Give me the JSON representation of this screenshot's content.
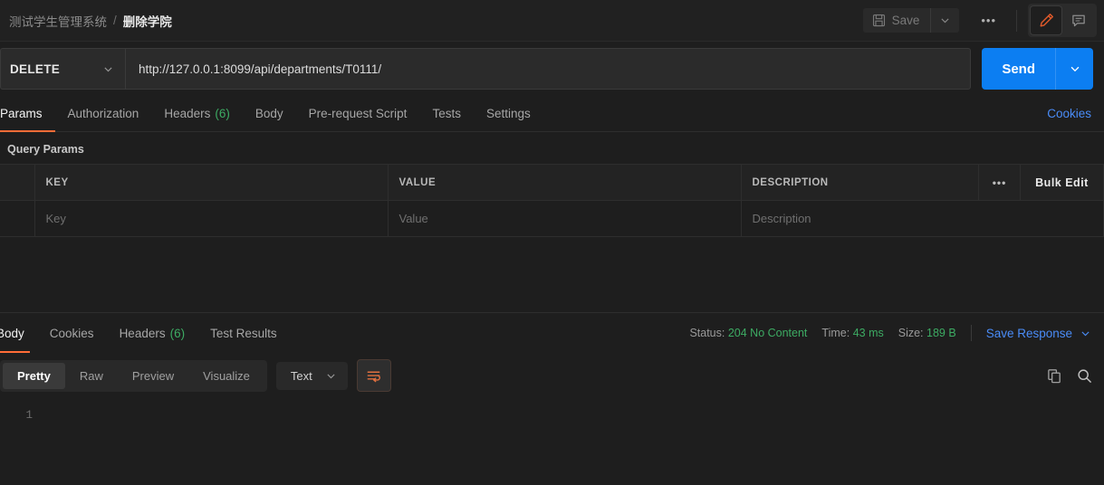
{
  "topbar": {
    "breadcrumb": {
      "collection": "测试学生管理系统",
      "separator": "/",
      "current": "删除学院"
    },
    "save_label": "Save",
    "save_icon": "floppy-disk-icon",
    "save_caret_icon": "chevron-down-icon",
    "more_label": "•••",
    "edit_icon": "pencil-icon",
    "comment_icon": "comment-icon",
    "accent_orange": "#ff6c37"
  },
  "request": {
    "method": "DELETE",
    "method_caret_icon": "chevron-down-icon",
    "url": "http://127.0.0.1:8099/api/departments/T0111/",
    "url_placeholder": "Enter request URL",
    "send_label": "Send",
    "send_caret_icon": "chevron-down-icon",
    "send_color": "#0c7ef2",
    "tabs": [
      {
        "label": "Params",
        "active": true
      },
      {
        "label": "Authorization",
        "active": false
      },
      {
        "label": "Headers",
        "count": "(6)",
        "active": false
      },
      {
        "label": "Body",
        "active": false
      },
      {
        "label": "Pre-request Script",
        "active": false
      },
      {
        "label": "Tests",
        "active": false
      },
      {
        "label": "Settings",
        "active": false
      }
    ],
    "cookies_label": "Cookies",
    "cookies_color": "#4a8cf7"
  },
  "query_params": {
    "title": "Query Params",
    "headers": {
      "key": "KEY",
      "value": "VALUE",
      "description": "DESCRIPTION"
    },
    "more_icon": "•••",
    "bulk_edit_label": "Bulk Edit",
    "rows": [
      {
        "key": "Key",
        "value": "Value",
        "description": "Description",
        "placeholder": true
      }
    ]
  },
  "response": {
    "tabs": [
      {
        "label": "Body",
        "active": true
      },
      {
        "label": "Cookies",
        "active": false
      },
      {
        "label": "Headers",
        "count": "(6)",
        "active": false
      },
      {
        "label": "Test Results",
        "active": false
      }
    ],
    "status_label": "Status:",
    "status_value": "204 No Content",
    "time_label": "Time:",
    "time_value": "43 ms",
    "size_label": "Size:",
    "size_value": "189 B",
    "status_color": "#3dab63",
    "save_response_label": "Save Response",
    "save_response_caret_icon": "chevron-down-icon",
    "viewer_modes": [
      {
        "label": "Pretty",
        "active": true
      },
      {
        "label": "Raw",
        "active": false
      },
      {
        "label": "Preview",
        "active": false
      },
      {
        "label": "Visualize",
        "active": false
      }
    ],
    "format_value": "Text",
    "format_caret_icon": "chevron-down-icon",
    "wrap_icon": "word-wrap-icon",
    "copy_icon": "copy-icon",
    "search_icon": "search-icon",
    "body_lines": [
      {
        "number": "1",
        "text": ""
      }
    ]
  }
}
